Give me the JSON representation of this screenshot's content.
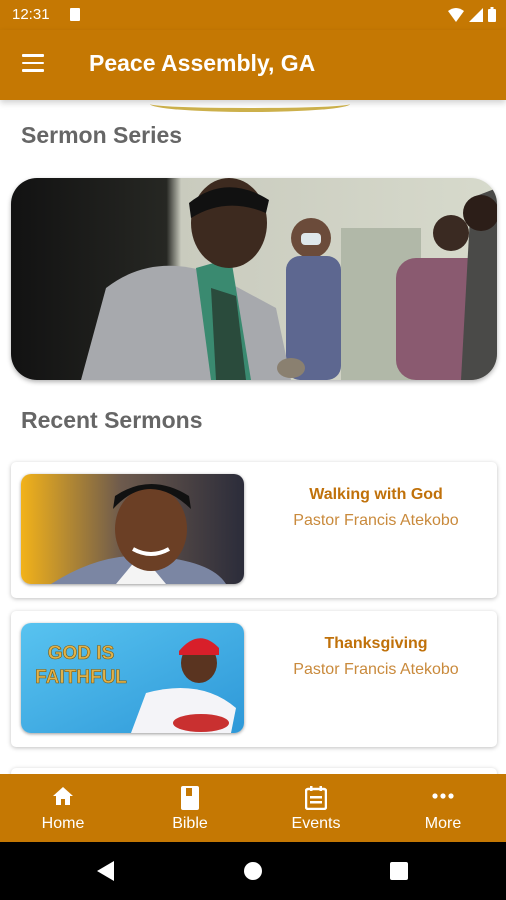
{
  "status_bar": {
    "time": "12:31"
  },
  "app_bar": {
    "title": "Peace Assembly, GA"
  },
  "sections": {
    "series_title": "Sermon Series",
    "recent_title": "Recent Sermons"
  },
  "sermons": [
    {
      "title": "Walking with God",
      "pastor": "Pastor Francis Atekobo"
    },
    {
      "title": "Thanksgiving",
      "pastor": "Pastor Francis Atekobo",
      "thumb_text": "GOD IS FAITHFUL"
    }
  ],
  "bottom_nav": [
    {
      "label": "Home",
      "icon": "home-icon"
    },
    {
      "label": "Bible",
      "icon": "book-icon"
    },
    {
      "label": "Events",
      "icon": "calendar-icon"
    },
    {
      "label": "More",
      "icon": "more-horizontal-icon"
    }
  ],
  "colors": {
    "primary": "#c57803",
    "sermon_title": "#c0710a",
    "pastor": "#c98a3c",
    "section_heading": "#666666"
  }
}
